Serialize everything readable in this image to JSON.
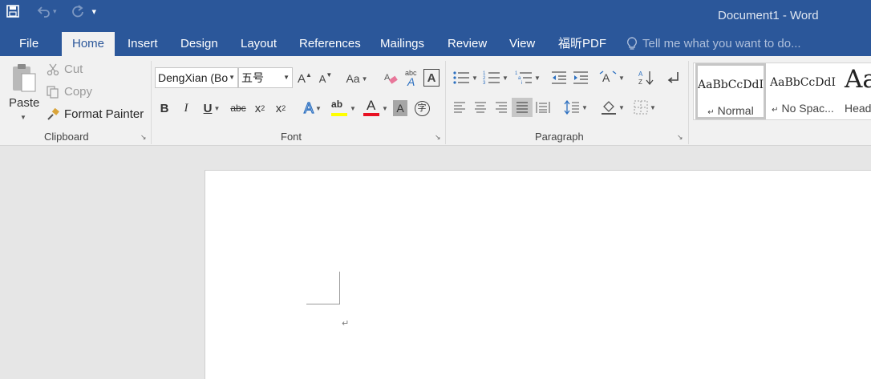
{
  "window": {
    "title": "Document1 - Word"
  },
  "qat": {
    "save": "save-icon",
    "undo": "undo-icon",
    "redo": "redo-icon",
    "customize": "▾"
  },
  "tabs": [
    {
      "label": "File"
    },
    {
      "label": "Home"
    },
    {
      "label": "Insert"
    },
    {
      "label": "Design"
    },
    {
      "label": "Layout"
    },
    {
      "label": "References"
    },
    {
      "label": "Mailings"
    },
    {
      "label": "Review"
    },
    {
      "label": "View"
    },
    {
      "label": "福昕PDF"
    }
  ],
  "tell_me": "Tell me what you want to do...",
  "clipboard": {
    "paste": "Paste",
    "cut": "Cut",
    "copy": "Copy",
    "format_painter": "Format Painter",
    "label": "Clipboard"
  },
  "font": {
    "name": "DengXian (Bo",
    "size": "五号",
    "label": "Font",
    "bold": "B",
    "italic": "I",
    "underline": "U",
    "strike": "abc",
    "sub": "x",
    "sub_suffix": "2",
    "sup": "x",
    "sup_suffix": "2",
    "grow": "A",
    "shrink": "A",
    "case": "Aa",
    "phonetic": "abc",
    "border_char": "A",
    "text_effect": "A",
    "highlight": "ab",
    "font_color": "A",
    "shade": "A",
    "enclose": "字",
    "highlight_color": "#ffff00",
    "font_color_value": "#e81123"
  },
  "paragraph": {
    "label": "Paragraph"
  },
  "styles": [
    {
      "sample": "AaBbCcDdI",
      "name": "Normal",
      "mark": "↵"
    },
    {
      "sample": "AaBbCcDdI",
      "name": "No Spac...",
      "mark": "↵"
    },
    {
      "sample": "Aa",
      "name": "Head"
    }
  ],
  "document": {
    "para_mark": "↵"
  }
}
